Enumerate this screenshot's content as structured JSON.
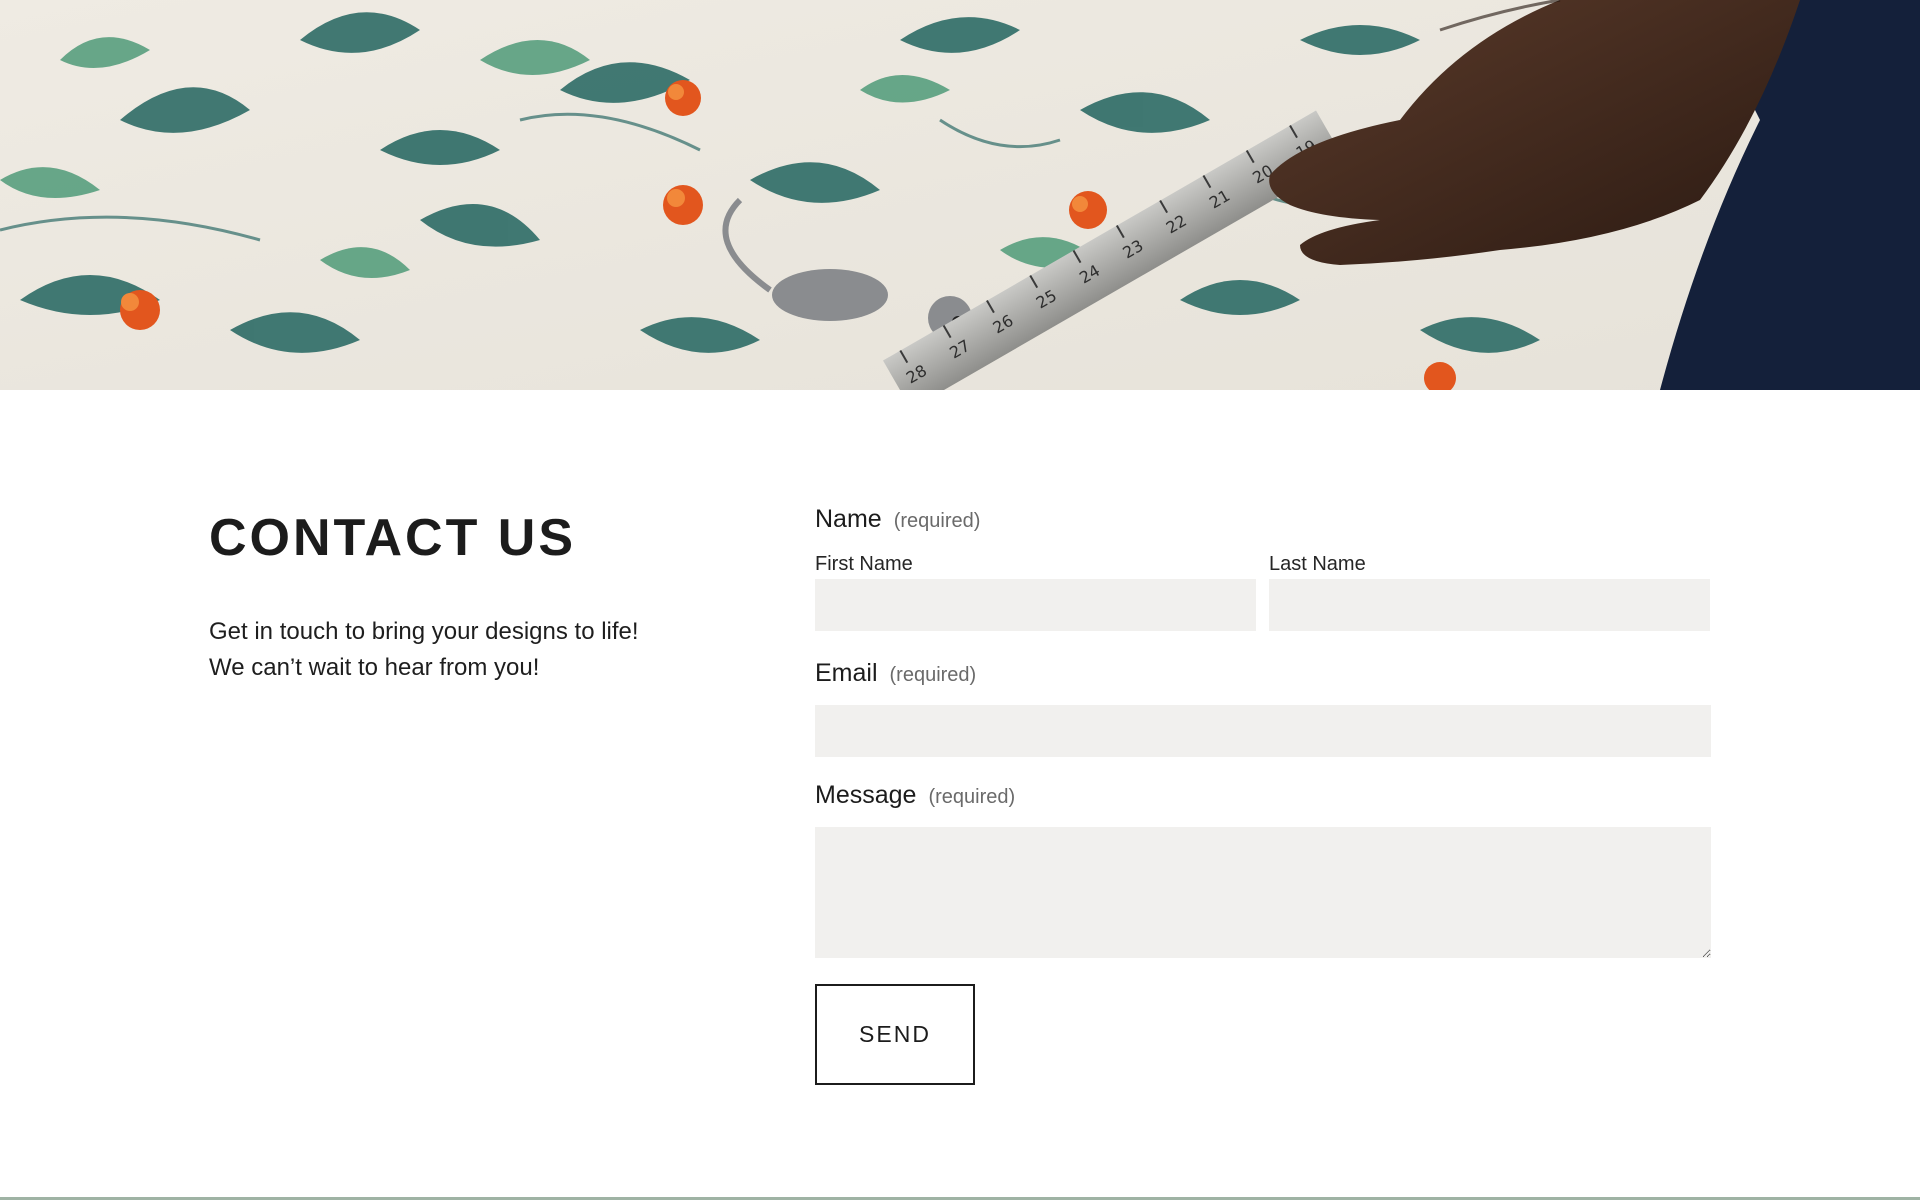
{
  "hero": {
    "image_alt": "Hand measuring botanical print fabric with a metal ruler",
    "ruler_numbers": [
      "28",
      "27",
      "26",
      "25",
      "24",
      "23",
      "22",
      "21",
      "20",
      "19"
    ]
  },
  "contact": {
    "title": "CONTACT US",
    "intro_line_1": "Get in touch to bring your designs to life!",
    "intro_line_2": "We can’t wait to hear from you!"
  },
  "form": {
    "name": {
      "label": "Name",
      "required": "(required)",
      "first_name_label": "First Name",
      "first_name_value": "",
      "last_name_label": "Last Name",
      "last_name_value": ""
    },
    "email": {
      "label": "Email",
      "required": "(required)",
      "value": ""
    },
    "message": {
      "label": "Message",
      "required": "(required)",
      "value": ""
    },
    "send_label": "SEND"
  },
  "colors": {
    "input_bg": "#f1f0ee",
    "text": "#1c1c1c",
    "bottom_rule": "#9fb3a4"
  }
}
